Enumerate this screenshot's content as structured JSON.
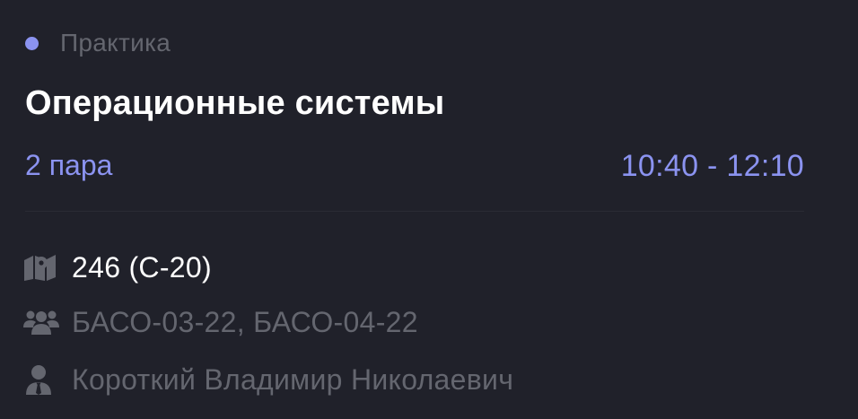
{
  "lesson": {
    "type_label": "Практика",
    "title": "Операционные системы",
    "pair_label": "2 пара",
    "time_range": "10:40 - 12:10",
    "room": "246 (С-20)",
    "groups": "БАСО-03-22, БАСО-04-22",
    "teacher": "Короткий Владимир Николаевич"
  },
  "icons": {
    "room": "map-icon",
    "groups": "users-icon",
    "teacher": "user-tie-icon"
  },
  "colors": {
    "background": "#20212a",
    "accent": "#8b93f0",
    "primary_text": "#ffffff",
    "secondary_text": "#64666f",
    "divider": "#2a2b34"
  }
}
